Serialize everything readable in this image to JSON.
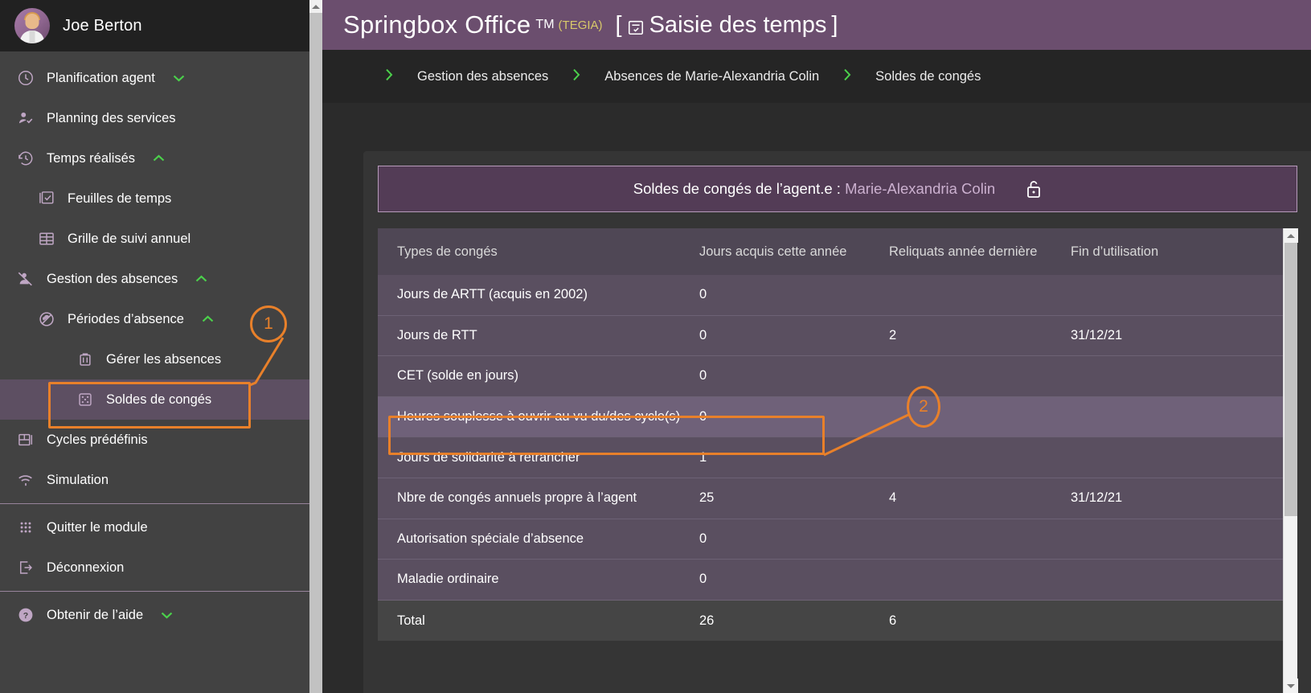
{
  "sidebar": {
    "user": {
      "name": "Joe Berton",
      "avatar_icon": "user-avatar"
    },
    "items": [
      {
        "label": "Planification agent",
        "icon": "clock-icon",
        "caret": "⌄",
        "indent": 0,
        "active": false
      },
      {
        "label": "Planning des services",
        "icon": "user-check-icon",
        "caret": "",
        "indent": 0,
        "active": false
      },
      {
        "label": "Temps réalisés",
        "icon": "clock-rewind-icon",
        "caret": "⌃",
        "indent": 0,
        "active": false
      },
      {
        "label": "Feuilles de temps",
        "icon": "checkbox-stack-icon",
        "caret": "",
        "indent": 1,
        "active": false
      },
      {
        "label": "Grille de suivi annuel",
        "icon": "grid-table-icon",
        "caret": "",
        "indent": 1,
        "active": false
      },
      {
        "label": "Gestion des absences",
        "icon": "person-absent-icon",
        "caret": "⌃",
        "indent": 0,
        "active": false
      },
      {
        "label": "Périodes d’absence",
        "icon": "no-cloud-icon",
        "caret": "⌃",
        "indent": 2,
        "active": false
      },
      {
        "label": "Gérer les absences",
        "icon": "suitcase-icon",
        "caret": "",
        "indent": 3,
        "active": false
      },
      {
        "label": "Soldes de congés",
        "icon": "dice-icon",
        "caret": "",
        "indent": 3,
        "active": true
      },
      {
        "label": "Cycles prédéfinis",
        "icon": "cycles-icon",
        "caret": "",
        "indent": 0,
        "active": false
      },
      {
        "label": "Simulation",
        "icon": "signal-icon",
        "caret": "",
        "indent": 0,
        "active": false
      },
      {
        "label": "Quitter le module",
        "icon": "apps-grid-icon",
        "caret": "",
        "indent": 0,
        "active": false
      },
      {
        "label": "Déconnexion",
        "icon": "logout-icon",
        "caret": "",
        "indent": 0,
        "active": false
      },
      {
        "label": "Obtenir de l’aide",
        "icon": "help-circle-icon",
        "caret": "⌄",
        "indent": 0,
        "active": false
      }
    ]
  },
  "header": {
    "brand": "Springbox Office",
    "tm": "TM",
    "tegia": "(TEGIA)",
    "module_open": "[",
    "module_title": "Saisie des temps",
    "module_close": "]",
    "module_icon": "calendar-check-icon"
  },
  "breadcrumb": {
    "separator": "›",
    "items": [
      "Gestion des absences",
      "Absences de Marie-Alexandria Colin",
      "Soldes de congés"
    ]
  },
  "card": {
    "title_prefix": "Soldes de congés de l’agent.e : ",
    "agent": "Marie-Alexandria Colin",
    "lock_icon": "unlock-icon"
  },
  "table": {
    "columns": [
      "Types de congés",
      "Jours acquis cette année",
      "Reliquats année dernière",
      "Fin d’utilisation"
    ],
    "rows": [
      {
        "type": "Jours de ARTT (acquis en 2002)",
        "acquis": "0",
        "reliquats": "",
        "fin": "",
        "highlight": false
      },
      {
        "type": "Jours de RTT",
        "acquis": "0",
        "reliquats": "2",
        "fin": "31/12/21",
        "highlight": false
      },
      {
        "type": "CET (solde en jours)",
        "acquis": "0",
        "reliquats": "",
        "fin": "",
        "highlight": false
      },
      {
        "type": "Heures souplesse à ouvrir au vu du/des cycle(s)",
        "acquis": "0",
        "reliquats": "",
        "fin": "",
        "highlight": true
      },
      {
        "type": "Jours de solidarité à retrancher",
        "acquis": "1",
        "reliquats": "",
        "fin": "",
        "highlight": false
      },
      {
        "type": "Nbre de congés annuels propre à l’agent",
        "acquis": "25",
        "reliquats": "4",
        "fin": "31/12/21",
        "highlight": false
      },
      {
        "type": "Autorisation spéciale d’absence",
        "acquis": "0",
        "reliquats": "",
        "fin": "",
        "highlight": false
      },
      {
        "type": "Maladie ordinaire",
        "acquis": "0",
        "reliquats": "",
        "fin": "",
        "highlight": false
      }
    ],
    "total": {
      "type": "Total",
      "acquis": "26",
      "reliquats": "6",
      "fin": ""
    }
  },
  "annotations": [
    {
      "number": "1",
      "target": "sidebar-item-soldes-de-conges"
    },
    {
      "number": "2",
      "target": "table-row-heures-souplesse"
    }
  ],
  "colors": {
    "accent_purple": "#6b4e6e",
    "annotation_orange": "#e8802a",
    "caret_green": "#4bd14b",
    "tegia_yellow": "#d8c96a",
    "sidebar_bg": "#424242",
    "row_bg": "#5a4f60",
    "row_highlight": "#6f6179"
  },
  "scrollbars": {
    "left_arrow_up": "▲",
    "right_arrow_up": "▲",
    "right_arrow_down": "▼"
  }
}
